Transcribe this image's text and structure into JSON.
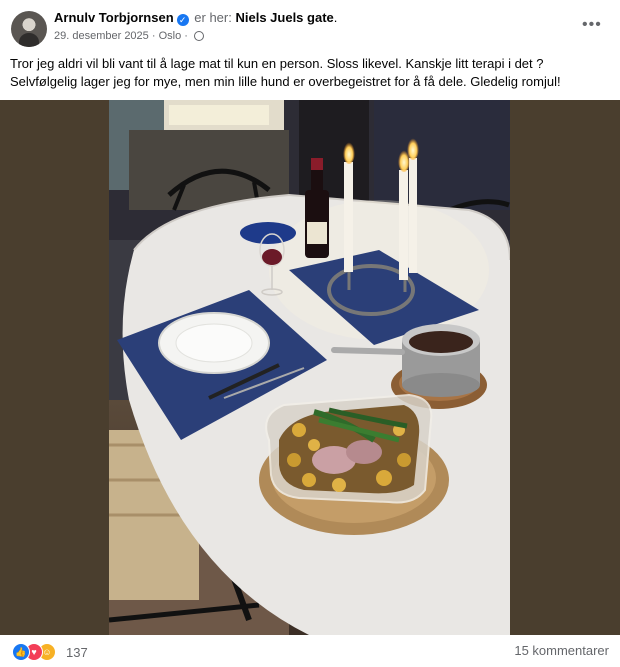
{
  "post": {
    "author": "Arnulv Torbjornsen",
    "verified_icon": "verified-badge-icon",
    "location_prefix": "er her:",
    "location": "Niels Juels gate",
    "location_suffix": ".",
    "date": "29. desember 2025",
    "separator": "·",
    "place": "Oslo",
    "separator2": "·",
    "privacy_icon": "globe-icon",
    "more_icon": "more-options-icon",
    "caption_line1": "Tror jeg aldri vil bli vant til å lage mat til kun en person. Sloss likevel. Kanskje litt terapi i det ?",
    "caption_line2": "Selvfølgelig lager jeg for mye, men  min lille hund er overbegeistret for å få dele. Gledelig romjul!"
  },
  "footer": {
    "reaction_icons": [
      "like-icon",
      "love-icon",
      "care-icon"
    ],
    "reaction_count": "137",
    "comments_label": "15 kommentarer"
  },
  "colors": {
    "accent": "#1877f2",
    "muted": "#65676b",
    "photo_surround": "#4a3e2e"
  }
}
